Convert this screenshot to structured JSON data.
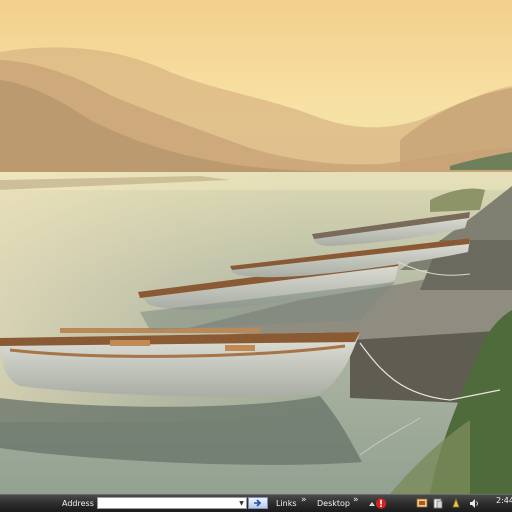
{
  "taskbar": {
    "address_label": "Address",
    "address_value": "",
    "links_label": "Links",
    "desktop_label": "Desktop",
    "chevron": "»",
    "clock": "2:44"
  },
  "icons": {
    "go": "go-arrow-icon",
    "dropdown": "chevron-down-icon",
    "tray": [
      "expand-arrow-icon",
      "security-shield-icon",
      "network-icon",
      "folder-icon",
      "device-icon",
      "speaker-icon"
    ]
  },
  "colors": {
    "taskbar": "#2a2a2a",
    "sky": "#f4d38f",
    "water": "#a8b8a8"
  }
}
